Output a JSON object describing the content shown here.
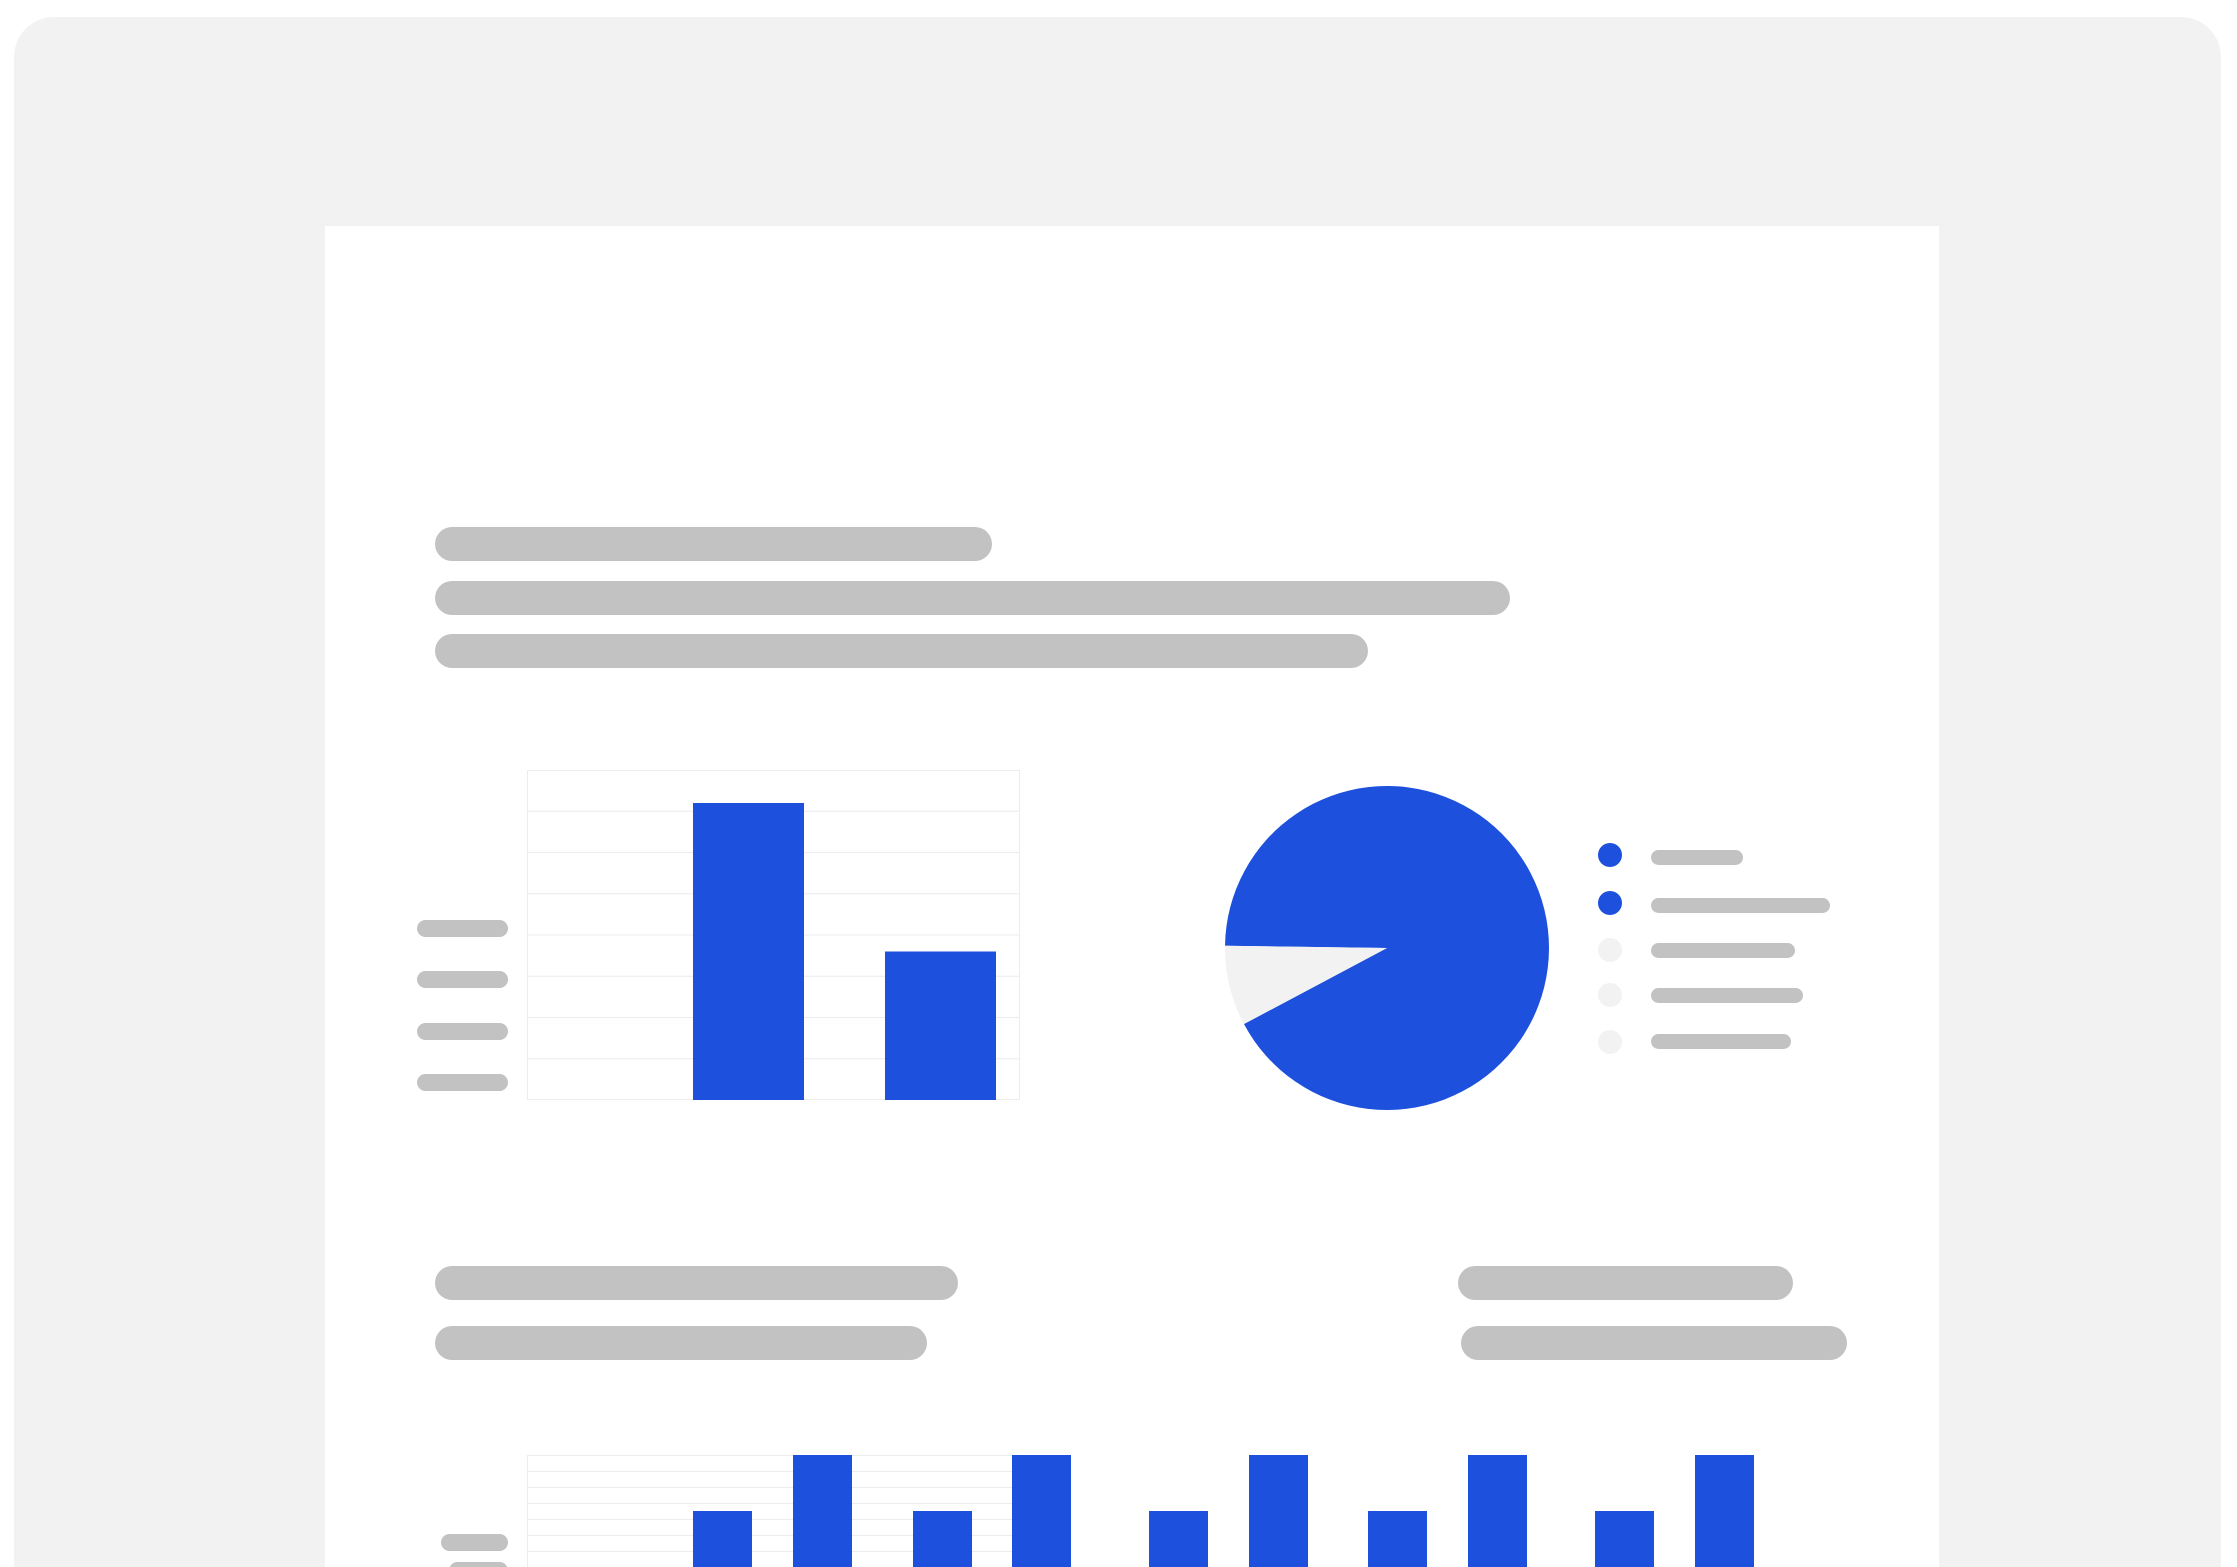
{
  "colors": {
    "accent": "#1d50dc",
    "placeholder": "#c2c2c2",
    "frame_bg": "#f2f2f2",
    "page_bg": "#ffffff",
    "grid": "#ececec",
    "muted_slice": "#f2f2f2"
  },
  "icons": {
    "legend_markers": [
      "filled-dot-icon",
      "filled-dot-icon",
      "faded-dot-icon",
      "faded-dot-icon",
      "faded-dot-icon"
    ]
  },
  "chart_data": [
    {
      "type": "bar",
      "title": "",
      "xlabel": "",
      "ylabel": "",
      "categories": [
        "",
        ""
      ],
      "values": [
        7.2,
        3.6
      ],
      "ylim": [
        0,
        8
      ],
      "grid": true,
      "tick_labels": "placeholder"
    },
    {
      "type": "pie",
      "title": "",
      "slices": [
        {
          "label": "",
          "value": 92,
          "color": "#1d50dc"
        },
        {
          "label": "",
          "value": 8,
          "color": "#f2f2f2"
        }
      ],
      "legend_position": "right",
      "legend_entries": 5
    },
    {
      "type": "bar",
      "title": "",
      "xlabel": "",
      "ylabel": "",
      "values": [
        2.5,
        5,
        2.5,
        5,
        2.5,
        5,
        2.5,
        5,
        2.5,
        5
      ],
      "ylim": [
        0,
        5.5
      ],
      "grid": true,
      "cropped": true
    }
  ]
}
